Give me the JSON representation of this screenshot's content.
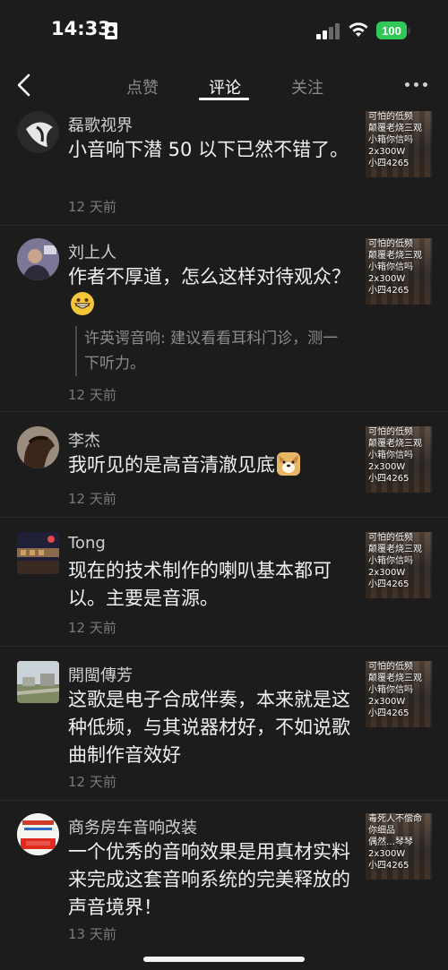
{
  "status_bar": {
    "time": "14:33",
    "battery": "100"
  },
  "nav": {
    "tabs": [
      {
        "label": "点赞"
      },
      {
        "label": "评论"
      },
      {
        "label": "关注"
      }
    ]
  },
  "thumbnail": {
    "lines": [
      "可怕的低频",
      "颠覆老烧三观",
      "小箱你信吗",
      "2x300W",
      "小四4265"
    ],
    "lines_alt": [
      "毒死人不偿命",
      "你细品",
      "偶然…琴琴",
      "2x300W",
      "小四4265"
    ]
  },
  "comments": [
    {
      "name": "磊歌视界",
      "text": "小音响下潜 50 以下已然不错了。",
      "time": "12 天前"
    },
    {
      "name": "刘上人",
      "text": "作者不厚道，怎么这样对待观众？",
      "reply": "许英谔音响: 建议看看耳科门诊，测一下听力。",
      "time": "12 天前"
    },
    {
      "name": "李杰",
      "text": "我听见的是高音清澈见底",
      "time": "12 天前"
    },
    {
      "name": "Tong",
      "text": "现在的技术制作的喇叭基本都可以。主要是音源。",
      "time": "12 天前"
    },
    {
      "name": "開閩傳芳",
      "text": "这歌是电子合成伴奏，本来就是这种低频，与其说器材好，不如说歌曲制作音效好",
      "time": "12 天前"
    },
    {
      "name": "商务房车音响改装",
      "text": "一个优秀的音响效果是用真材实料来完成这套音响系统的完美释放的声音境界！",
      "time": "13 天前"
    }
  ]
}
